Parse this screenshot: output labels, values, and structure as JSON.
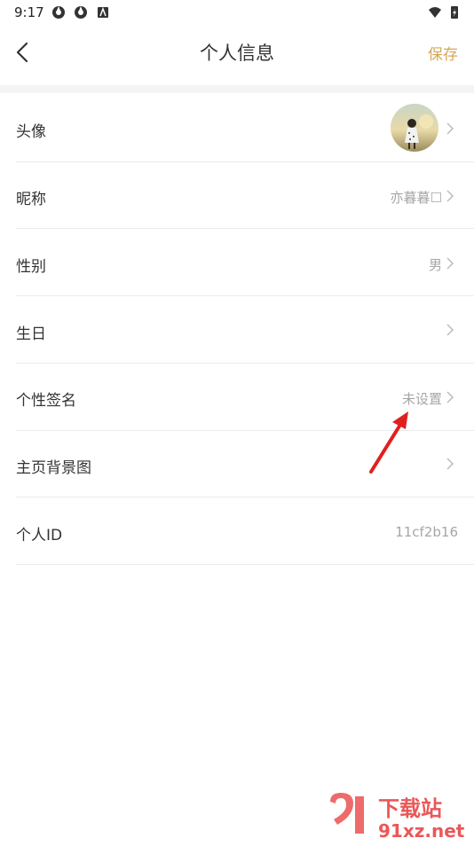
{
  "status": {
    "time": "9:17"
  },
  "header": {
    "title": "个人信息",
    "save_label": "保存"
  },
  "rows": [
    {
      "label": "头像",
      "value": ""
    },
    {
      "label": "昵称",
      "value": "亦暮暮☐"
    },
    {
      "label": "性别",
      "value": "男"
    },
    {
      "label": "生日",
      "value": ""
    },
    {
      "label": "个性签名",
      "value": "未设置"
    },
    {
      "label": "主页背景图",
      "value": ""
    },
    {
      "label": "个人ID",
      "value": "11cf2b16"
    }
  ],
  "watermark": {
    "top": "下载站",
    "bottom": "91xz.net"
  },
  "colors": {
    "accent": "#d6a85b",
    "arrow": "#e02020"
  }
}
